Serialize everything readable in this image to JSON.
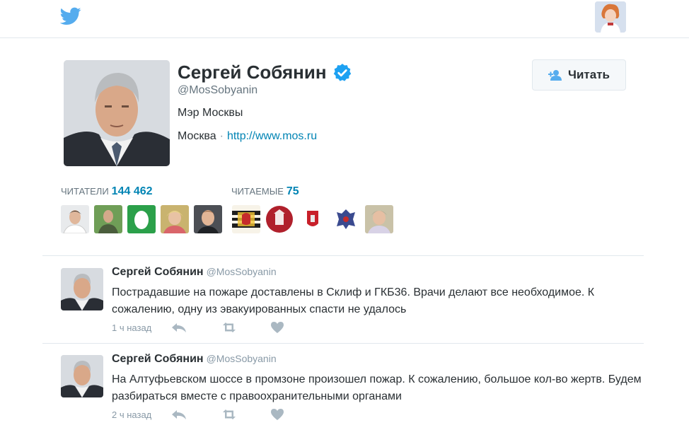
{
  "topbar": {
    "logo_icon": "twitter-bird-icon",
    "user_avatar_icon": "user-avatar-icon"
  },
  "profile": {
    "name": "Сергей Собянин",
    "handle": "@MosSobyanin",
    "bio": "Мэр Москвы",
    "location": "Москва",
    "separator": "·",
    "url": "http://www.mos.ru",
    "follow_label": "Читать",
    "verified_icon": "verified-badge-icon"
  },
  "stats": {
    "followers_label": "ЧИТАТЕЛИ",
    "followers_count": "144 462",
    "following_label": "ЧИТАЕМЫЕ",
    "following_count": "75"
  },
  "tweets": [
    {
      "name": "Сергей Собянин",
      "handle": "@MosSobyanin",
      "text": "Пострадавшие на пожаре доставлены в Склиф и ГКБ36. Врачи делают все необходимое. К сожалению, одну из эвакуированных спасти не удалось",
      "time": "1 ч назад"
    },
    {
      "name": "Сергей Собянин",
      "handle": "@MosSobyanin",
      "text": "На Алтуфьевском шоссе в промзоне произошел пожар. К сожалению, большое кол-во жертв. Будем разбираться вместе с правоохранительными органами",
      "time": "2 ч назад"
    }
  ],
  "colors": {
    "accent": "#0084b4",
    "twitter_blue": "#55acee",
    "verified": "#1da1f2",
    "muted": "#8899a6"
  }
}
